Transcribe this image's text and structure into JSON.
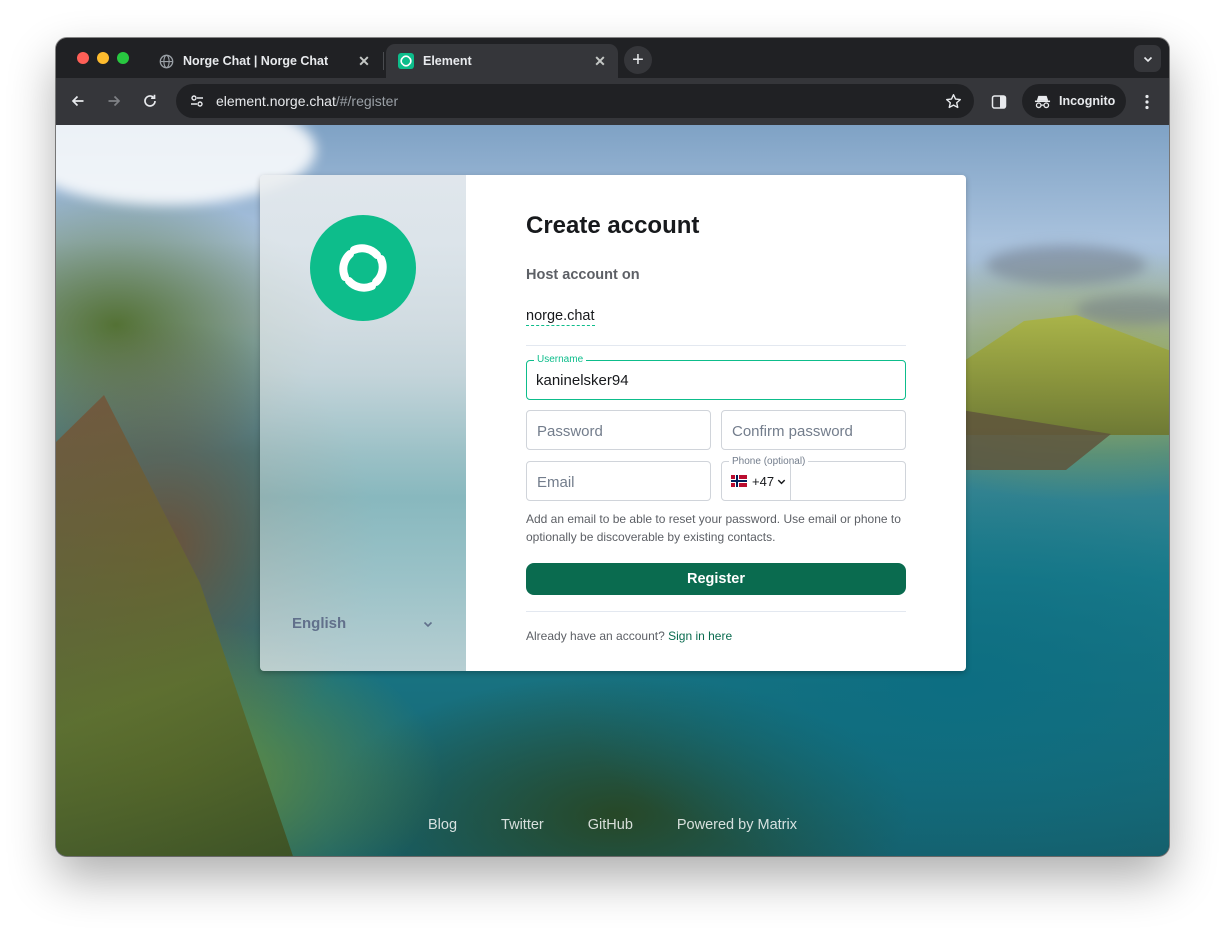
{
  "browser": {
    "tabs": [
      {
        "title": "Norge Chat | Norge Chat",
        "icon": "globe-icon",
        "active": false
      },
      {
        "title": "Element",
        "icon": "element-logo-icon",
        "active": true
      }
    ],
    "new_tab_icon": "plus-icon",
    "tab_search_icon": "chevron-down-icon",
    "url_host": "element.norge.chat",
    "url_path": "/#/register",
    "incognito_label": "Incognito"
  },
  "auth": {
    "heading": "Create account",
    "host_label": "Host account on",
    "host_value": "norge.chat",
    "username": {
      "label": "Username",
      "value": "kaninelsker94"
    },
    "password_placeholder": "Password",
    "confirm_placeholder": "Confirm password",
    "email_placeholder": "Email",
    "phone": {
      "label": "Phone (optional)",
      "country_code": "+47",
      "country_flag": "norway-flag",
      "value": ""
    },
    "helper_text": "Add an email to be able to reset your password. Use email or phone to optionally be discoverable by existing contacts.",
    "register_label": "Register",
    "signin_prompt": "Already have an account?",
    "signin_link": "Sign in here",
    "language": "English"
  },
  "footer": {
    "links": [
      "Blog",
      "Twitter",
      "GitHub",
      "Powered by Matrix"
    ]
  },
  "colors": {
    "brand_green": "#0dbd8b",
    "button_green": "#0a6b4f",
    "link_green": "#0a6b4f"
  }
}
